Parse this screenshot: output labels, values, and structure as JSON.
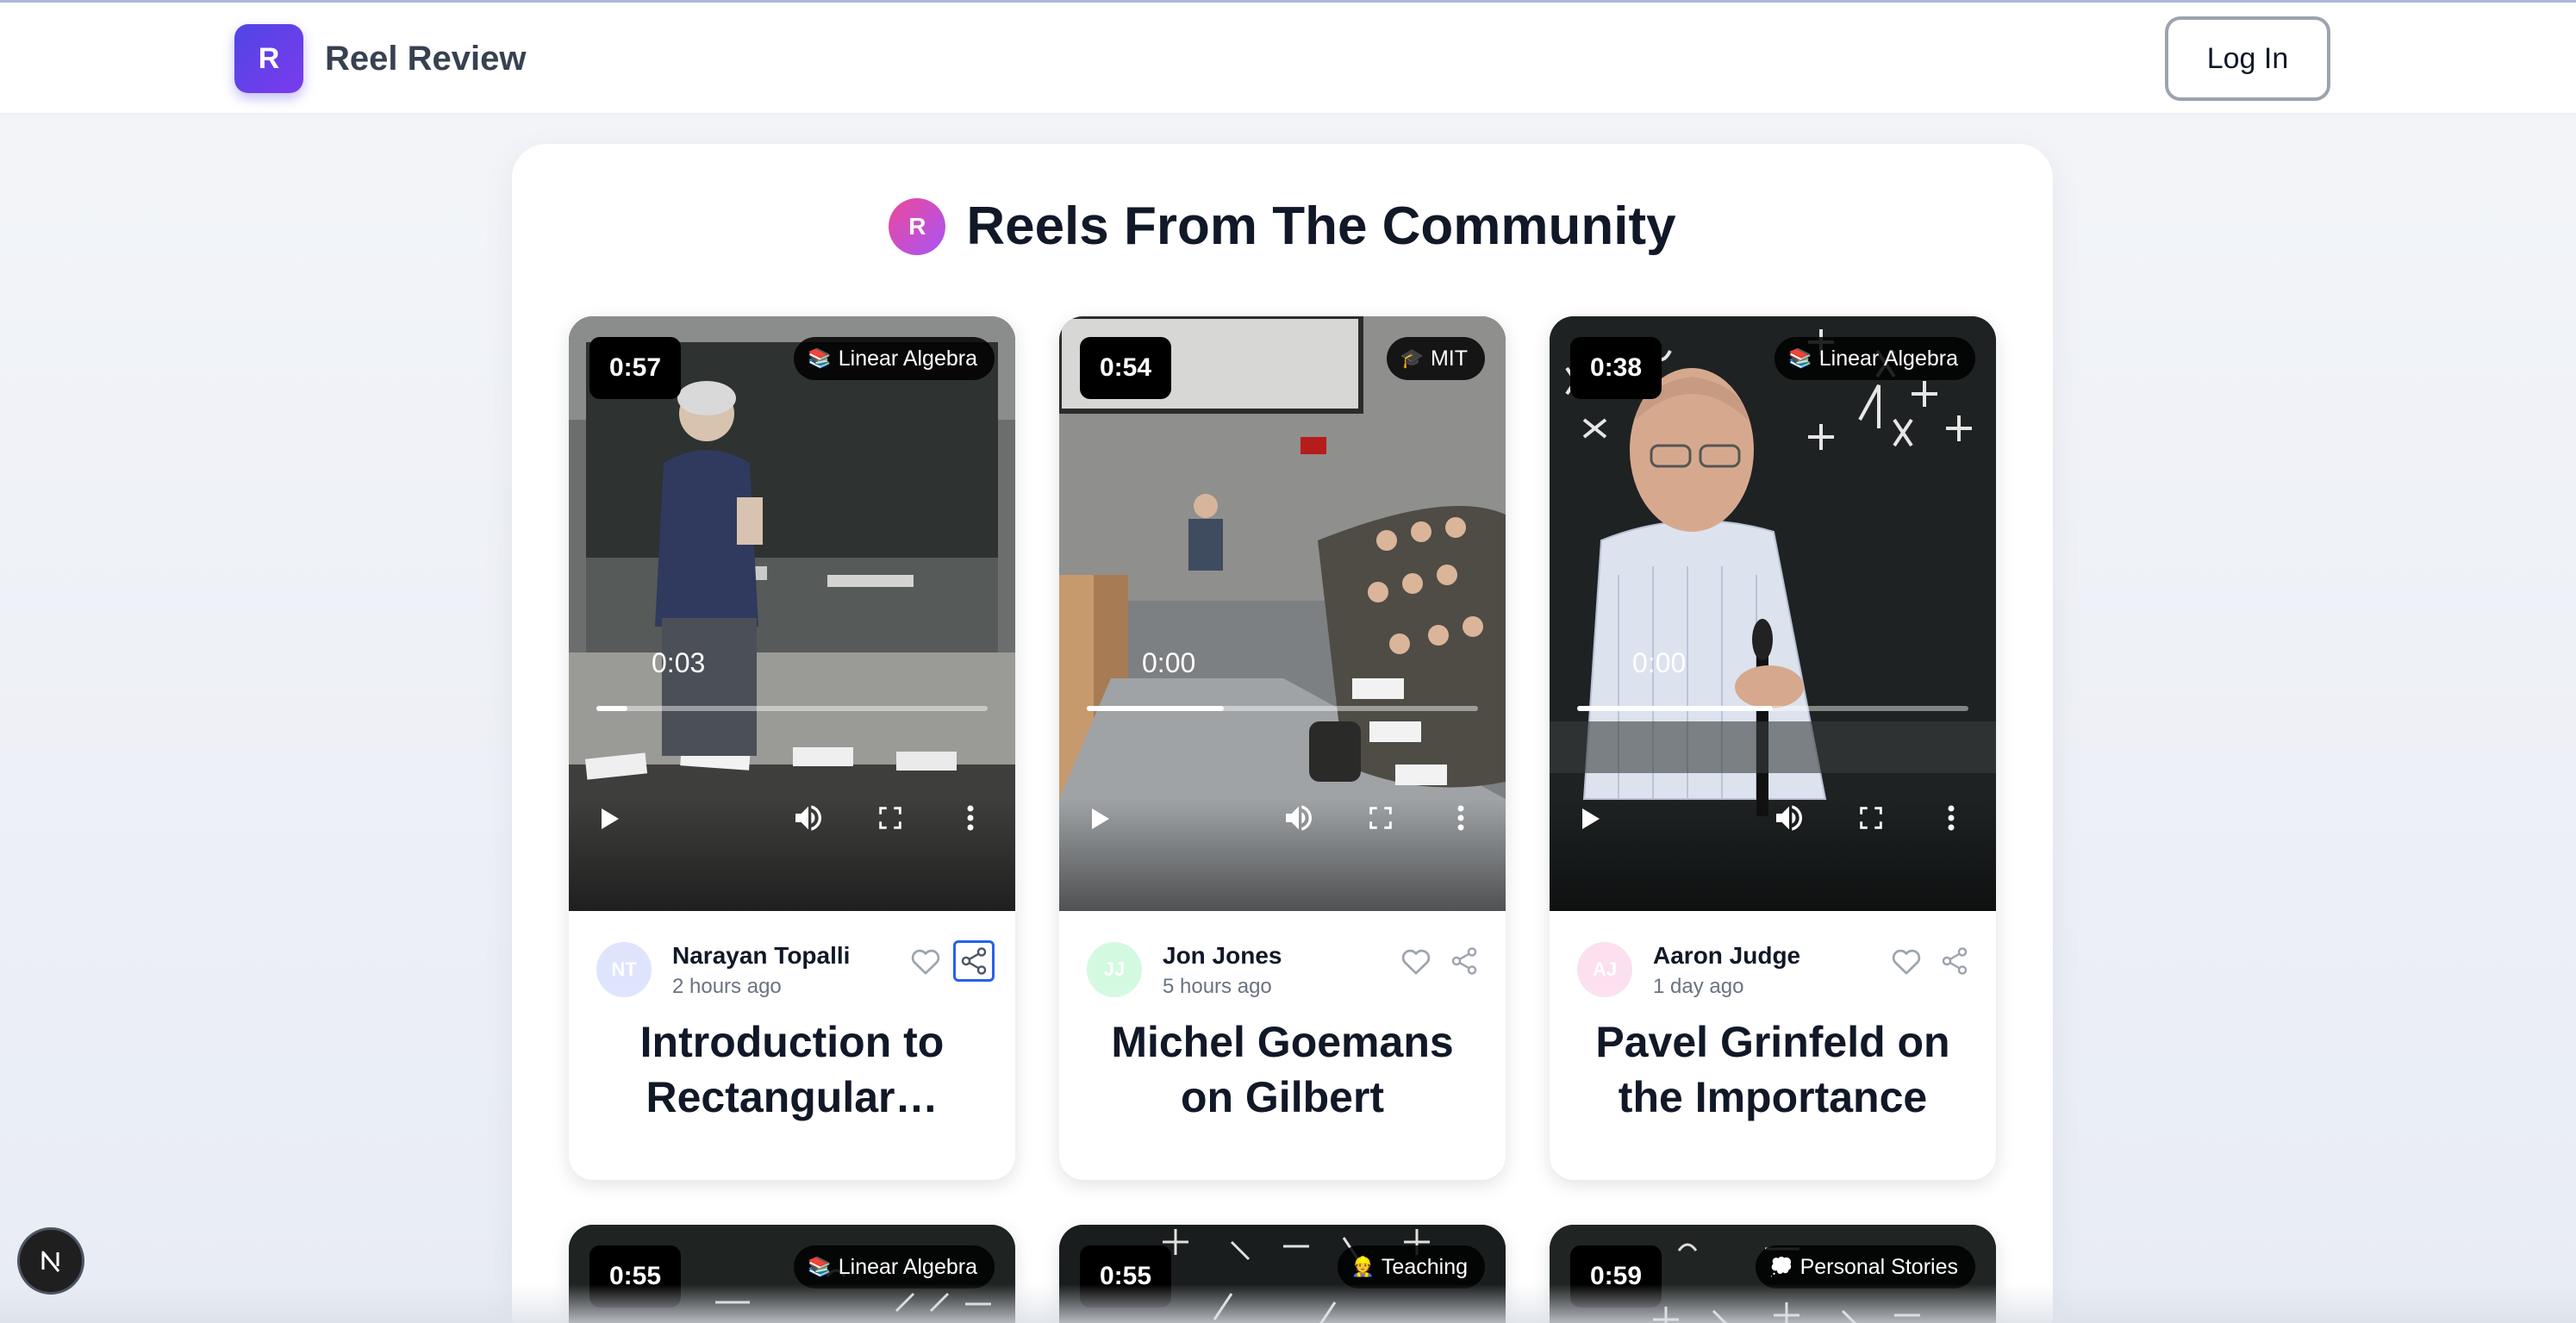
{
  "app": {
    "name": "Reel Review",
    "logo_letter": "R"
  },
  "header": {
    "login_label": "Log In"
  },
  "panel": {
    "badge_letter": "R",
    "title": "Reels From The Community"
  },
  "reels": [
    {
      "duration": "0:57",
      "tag_emoji": "📚",
      "tag": "Linear Algebra",
      "time": "0:03",
      "progress": 0.08,
      "initials": "NT",
      "author": "Narayan Topalli",
      "posted": "2 hours ago",
      "title": "Introduction to Rectangular…",
      "share_focused": true,
      "avatar_color": "#a5b4fc",
      "scene": "strang"
    },
    {
      "duration": "0:54",
      "tag_emoji": "🎓",
      "tag": "MIT",
      "time": "0:00",
      "progress": 0.35,
      "initials": "JJ",
      "author": "Jon Jones",
      "posted": "5 hours ago",
      "title": "Michel Goemans on Gilbert Strang's…",
      "share_focused": false,
      "avatar_color": "#86efac",
      "scene": "classroom"
    },
    {
      "duration": "0:38",
      "tag_emoji": "📚",
      "tag": "Linear Algebra",
      "time": "0:00",
      "progress": 0.5,
      "initials": "AJ",
      "author": "Aaron Judge",
      "posted": "1 day ago",
      "title": "Pavel Grinfeld on the Importance of…",
      "share_focused": false,
      "avatar_color": "#f9a8d4",
      "scene": "grinfeld"
    },
    {
      "duration": "0:55",
      "tag_emoji": "📚",
      "tag": "Linear Algebra",
      "scene": "board"
    },
    {
      "duration": "0:55",
      "tag_emoji": "👷",
      "tag": "Teaching",
      "scene": "board"
    },
    {
      "duration": "0:59",
      "tag_emoji": "💭",
      "tag": "Personal Stories",
      "scene": "board"
    }
  ]
}
